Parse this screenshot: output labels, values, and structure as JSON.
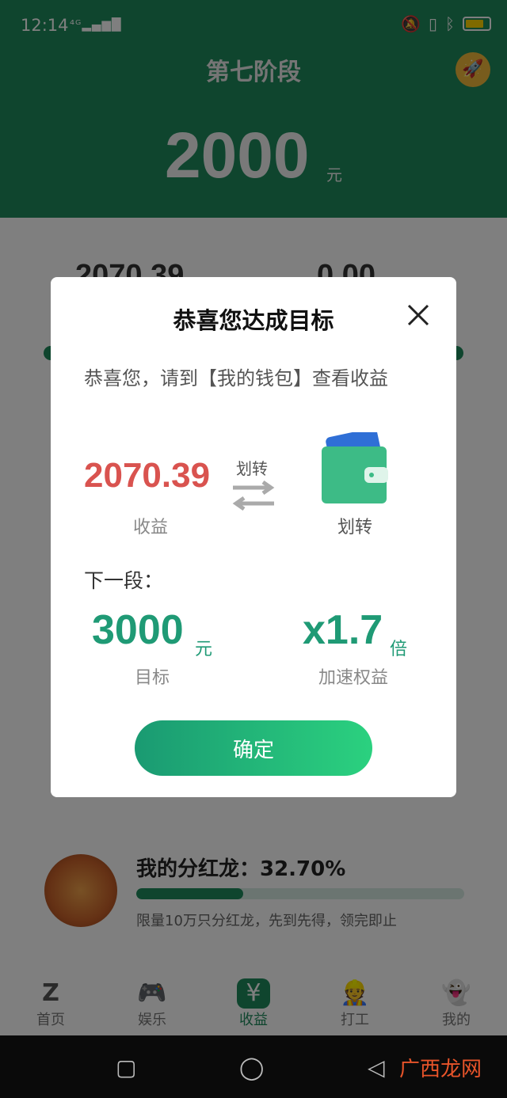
{
  "status_bar": {
    "time": "12:14",
    "network": "4G",
    "battery_color": "#ffd400"
  },
  "header": {
    "title": "第七阶段",
    "amount": "2000",
    "unit": "元",
    "rocket_icon": "rocket-icon"
  },
  "background": {
    "value_left": "2070.39",
    "value_right": "0.00"
  },
  "dividend": {
    "title": "我的分红龙：32.70%",
    "progress": 0.327,
    "note": "限量10万只分红龙，先到先得，领完即止"
  },
  "tabs": [
    {
      "label": "首页",
      "icon": "home-logo-icon"
    },
    {
      "label": "娱乐",
      "icon": "gamepad-icon"
    },
    {
      "label": "收益",
      "icon": "money-bag-icon"
    },
    {
      "label": "打工",
      "icon": "worker-icon"
    },
    {
      "label": "我的",
      "icon": "ghost-profile-icon"
    }
  ],
  "modal": {
    "title": "恭喜您达成目标",
    "message": "恭喜您，请到【我的钱包】查看收益",
    "income_value": "2070.39",
    "income_label": "收益",
    "transfer_arrow_label": "划转",
    "wallet_label": "划转",
    "next_label": "下一段：",
    "target_value": "3000",
    "target_unit": "元",
    "target_label": "目标",
    "multiplier_value": "x1.7",
    "multiplier_unit": "倍",
    "multiplier_label": "加速权益",
    "confirm_label": "确定"
  },
  "watermark": "广西龙网",
  "colors": {
    "brand_green": "#1e8a5c",
    "income_red": "#d9534f",
    "accent_teal": "#1f9a75"
  }
}
